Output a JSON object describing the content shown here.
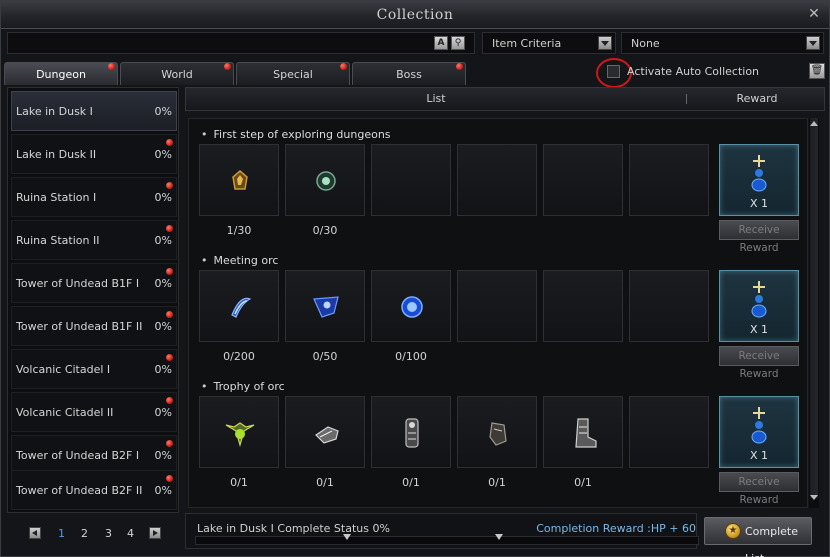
{
  "window": {
    "title": "Collection"
  },
  "search": {
    "value": "",
    "placeholder": "",
    "a_button": "A"
  },
  "filters": {
    "criteria": "Item Criteria",
    "value": "None"
  },
  "tabs": [
    {
      "label": "Dungeon",
      "active": true,
      "has_alert": true
    },
    {
      "label": "World",
      "active": false,
      "has_alert": true
    },
    {
      "label": "Special",
      "active": false,
      "has_alert": true
    },
    {
      "label": "Boss",
      "active": false,
      "has_alert": true
    }
  ],
  "auto_collection": {
    "label": "Activate Auto Collection",
    "checked": false
  },
  "list_header": {
    "list": "List",
    "reward": "Reward"
  },
  "dungeons": [
    {
      "name": "Lake in Dusk I",
      "pct": "0%",
      "alert": false,
      "selected": true
    },
    {
      "name": "Lake in Dusk II",
      "pct": "0%",
      "alert": true
    },
    {
      "name": "Ruina Station I",
      "pct": "0%",
      "alert": true
    },
    {
      "name": "Ruina Station II",
      "pct": "0%",
      "alert": true
    },
    {
      "name": "Tower of Undead B1F I",
      "pct": "0%",
      "alert": true
    },
    {
      "name": "Tower of Undead B1F II",
      "pct": "0%",
      "alert": true
    },
    {
      "name": "Volcanic Citadel I",
      "pct": "0%",
      "alert": true
    },
    {
      "name": "Volcanic Citadel II",
      "pct": "0%",
      "alert": true
    },
    {
      "name": "Tower of Undead B2F I",
      "pct": "0%",
      "alert": true
    },
    {
      "name": "Tower of Undead B2F II",
      "pct": "0%",
      "alert": true
    }
  ],
  "pager": {
    "pages": [
      "1",
      "2",
      "3",
      "4"
    ],
    "current": "1"
  },
  "groups": [
    {
      "title": "First step of exploring dungeons",
      "items": [
        {
          "count": "1/30",
          "icon": "amber-stone-icon"
        },
        {
          "count": "0/30",
          "icon": "green-orb-icon"
        }
      ],
      "reward_qty": "X 1",
      "receive_label": "Receive Reward"
    },
    {
      "title": "Meeting orc",
      "items": [
        {
          "count": "0/200",
          "icon": "blue-slash-icon"
        },
        {
          "count": "0/50",
          "icon": "blue-crest-icon"
        },
        {
          "count": "0/100",
          "icon": "blue-orb-icon"
        }
      ],
      "reward_qty": "X 1",
      "receive_label": "Receive Reward"
    },
    {
      "title": "Trophy of orc",
      "items": [
        {
          "count": "0/1",
          "icon": "wing-emblem-icon"
        },
        {
          "count": "0/1",
          "icon": "gauntlet-icon"
        },
        {
          "count": "0/1",
          "icon": "armor-icon"
        },
        {
          "count": "0/1",
          "icon": "glove-icon"
        },
        {
          "count": "0/1",
          "icon": "boots-icon"
        }
      ],
      "reward_qty": "X 1",
      "receive_label": "Receive Reward"
    }
  ],
  "status": {
    "text": "Lake in Dusk I Complete Status 0%",
    "reward_label": "Completion Reward :HP + 60",
    "progress": 0
  },
  "complete_button": {
    "label": "Complete List"
  },
  "colors": {
    "accent": "#7ab8e8",
    "alert": "#c4160c",
    "page_current": "#5a9adf"
  }
}
